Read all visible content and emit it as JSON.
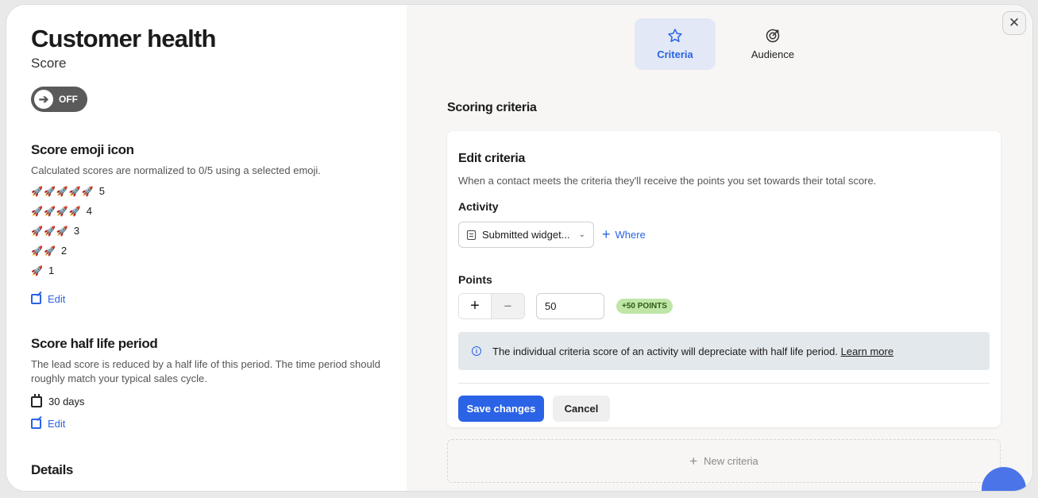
{
  "left": {
    "title": "Customer health",
    "subtitle": "Score",
    "toggle": {
      "state_label": "OFF",
      "icon": "arrow-right-icon"
    },
    "emoji_section": {
      "title": "Score emoji icon",
      "description": "Calculated scores are normalized to 0/5 using a selected emoji.",
      "emoji": "rocket",
      "rows": [
        {
          "rockets": "🚀🚀🚀🚀🚀",
          "value": "5"
        },
        {
          "rockets": "🚀🚀🚀🚀",
          "value": "4"
        },
        {
          "rockets": "🚀🚀🚀",
          "value": "3"
        },
        {
          "rockets": "🚀🚀",
          "value": "2"
        },
        {
          "rockets": "🚀",
          "value": "1"
        }
      ],
      "edit_label": "Edit"
    },
    "half_life_section": {
      "title": "Score half life period",
      "description": "The lead score is reduced by a half life of this period. The time period should roughly match your typical sales cycle.",
      "period": "30 days",
      "edit_label": "Edit"
    },
    "details_title": "Details"
  },
  "tabs": [
    {
      "label": "Criteria",
      "icon": "star-icon",
      "active": true
    },
    {
      "label": "Audience",
      "icon": "target-icon",
      "active": false
    }
  ],
  "close_icon": "close-icon",
  "scoring": {
    "title": "Scoring criteria",
    "card": {
      "title": "Edit criteria",
      "description": "When a contact meets the criteria they'll receive the points you set towards their total score.",
      "activity_label": "Activity",
      "activity_value": "Submitted widget...",
      "where_label": "Where",
      "points_label": "Points",
      "plus_label": "+",
      "minus_label": "−",
      "points_value": "50",
      "points_badge": "+50 POINTS",
      "info_text": "The individual criteria score of an activity will depreciate with half life period.",
      "info_link": "Learn more",
      "save_label": "Save changes",
      "cancel_label": "Cancel"
    },
    "new_criteria_label": "New criteria"
  },
  "colors": {
    "accent": "#2a63e6",
    "badge_bg": "#bfe6a6",
    "badge_text": "#2d5b16",
    "toggle_bg": "#5a5a5a"
  }
}
